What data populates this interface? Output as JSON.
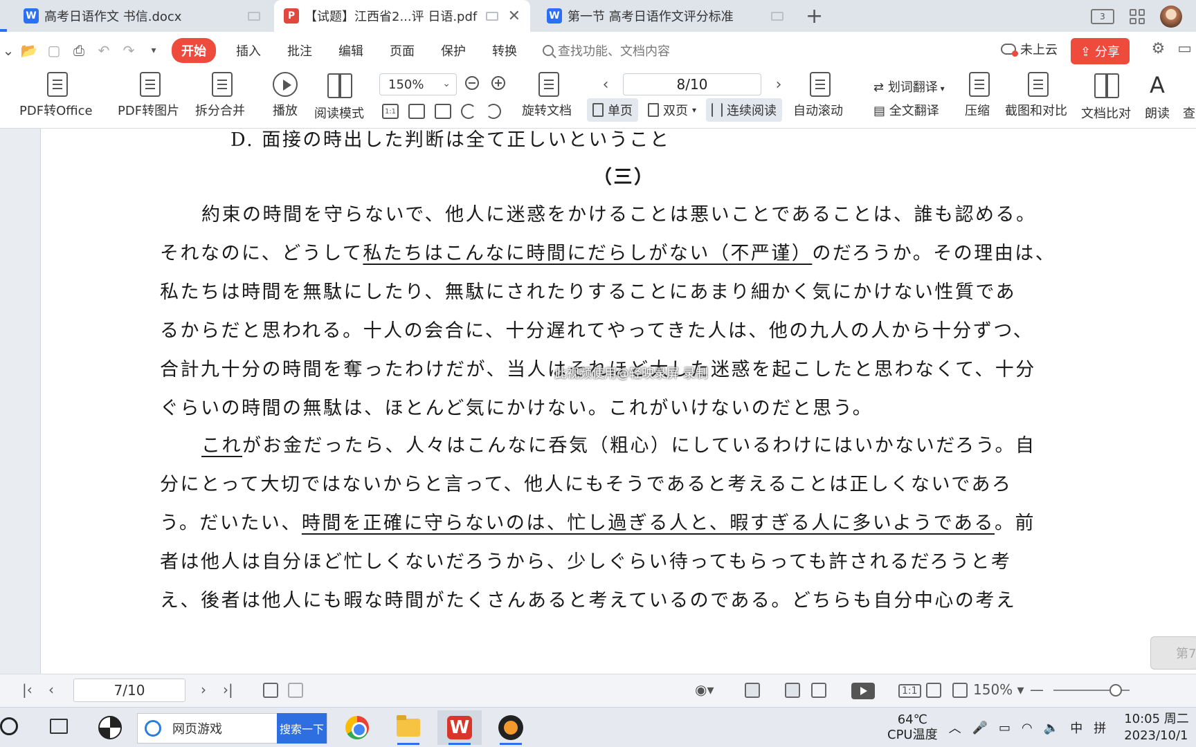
{
  "tabs": [
    {
      "label": "高考日语作文 书信.docx",
      "type": "w"
    },
    {
      "label": "【试题】江西省2...评 日语.pdf",
      "type": "p"
    },
    {
      "label": "第一节 高考日语作文评分标准",
      "type": "w"
    }
  ],
  "titlebar": {
    "layout_badge": "3",
    "add": "+",
    "close": "✕"
  },
  "menu": {
    "tabs": [
      "开始",
      "插入",
      "批注",
      "编辑",
      "页面",
      "保护",
      "转换"
    ],
    "search_placeholder": "查找功能、文档内容",
    "cloud_label": "未上云",
    "share_label": "分享"
  },
  "ribbon": {
    "pdf_to_office": "PDF转Office",
    "pdf_to_image": "PDF转图片",
    "split_merge": "拆分合并",
    "play": "播放",
    "read_mode": "阅读模式",
    "zoom": "150%",
    "rotate_doc": "旋转文档",
    "page_indicator": "8/10",
    "single_page": "单页",
    "double_page": "双页",
    "continuous": "连续阅读",
    "auto_scroll": "自动滚动",
    "word_translate": "划词翻译",
    "full_translate": "全文翻译",
    "compress": "压缩",
    "screenshot_compare": "截图和对比",
    "doc_compare": "文档比对",
    "read_aloud": "朗读",
    "more": "查",
    "actual_size": "1:1"
  },
  "document": {
    "option_d": "D. 面接の時出した判断は全て正しいということ",
    "section": "（三）",
    "p1_l1": "約束の時間を守らないで、他人に迷惑をかけることは悪いことであることは、誰も認める。",
    "p1_l2a": "それなのに、どうして",
    "p1_l2u": "私たちはこんなに時間にだらしがない（不严谨）",
    "p1_l2b": "のだろうか。その理由は、",
    "p1_l3": "私たちは時間を無駄にしたり、無駄にされたりすることにあまり細かく気にかけない性質であ",
    "p1_l4": "るからだと思われる。十人の会合に、十分遅れてやってきた人は、他の九人の人から十分ずつ、",
    "p1_l5": "合計九十分の時間を奪ったわけだが、当人はそれほど大した迷惑を起こしたと思わなくて、十分",
    "p1_l6": "ぐらいの時間の無駄は、ほとんど気にかけない。これがいけないのだと思う。",
    "p2_l1u": "これ",
    "p2_l1": "がお金だったら、人々はこんなに呑気（粗心）にしているわけにはいかないだろう。自",
    "p2_l2": "分にとって大切ではないからと言って、他人にもそうであると考えることは正しくないであろ",
    "p2_l3a": "う。だいたい、",
    "p2_l3u": "時間を正確に守らないのは、忙し過ぎる人と、暇すぎる人に多いようである",
    "p2_l3b": "。前",
    "p2_l4": "者は他人は自分ほど忙しくないだろうから、少しぐらい待ってもらっても許されるだろうと考",
    "p2_l5": "え、後者は他人にも暇な時間がたくさんあると考えているのである。どちらも自分中心の考え",
    "watermark": "此视频使用@轻映录屏 录制",
    "side_badge": "第7"
  },
  "statusbar": {
    "page": "7/10",
    "zoom": "150%",
    "actual_size": "1:1",
    "zoom_out": "—",
    "zoom_level": 0.82
  },
  "taskbar": {
    "search_text": "网页游戏",
    "search_button": "搜索一下",
    "temp": "64℃",
    "temp_label": "CPU温度",
    "ime1": "中",
    "ime2": "拼",
    "time": "10:05 周二",
    "date": "2023/10/1"
  }
}
